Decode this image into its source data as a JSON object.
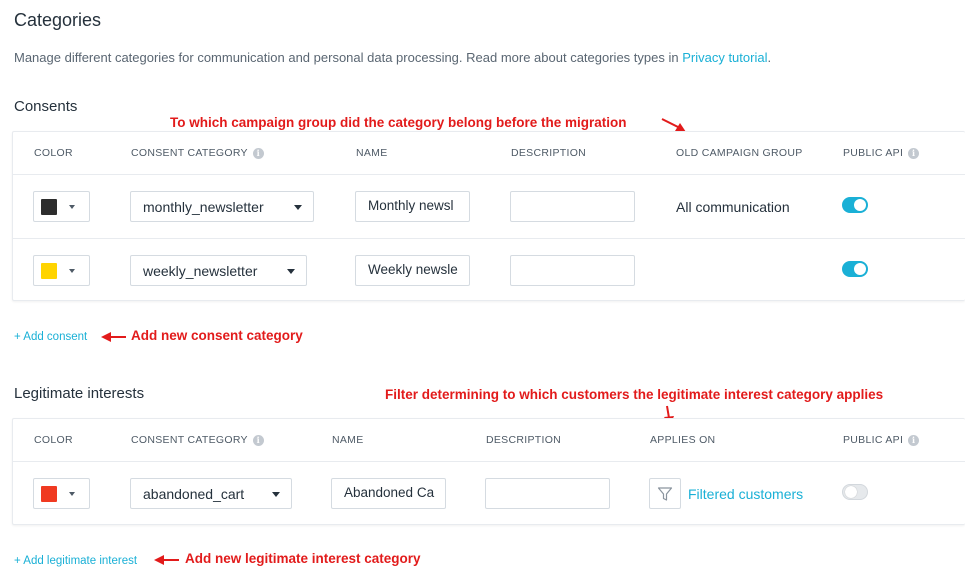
{
  "page": {
    "title": "Categories",
    "description": "Manage different categories for communication and personal data processing. Read more about categories types in ",
    "description_link": "Privacy tutorial",
    "description_end": "."
  },
  "consents": {
    "title": "Consents",
    "columns": {
      "color": "COLOR",
      "consent_category": "CONSENT CATEGORY",
      "name": "NAME",
      "description": "DESCRIPTION",
      "old_campaign_group": "OLD CAMPAIGN GROUP",
      "public_api": "PUBLIC API"
    },
    "rows": [
      {
        "color": "#2d2d2d",
        "category": "monthly_newsletter",
        "name": "Monthly newsl",
        "description": "",
        "old_campaign_group": "All communication",
        "public_api": true
      },
      {
        "color": "#ffd400",
        "category": "weekly_newsletter",
        "name": "Weekly newsle",
        "description": "",
        "old_campaign_group": "",
        "public_api": true
      }
    ],
    "add_label": "+ Add consent"
  },
  "legitimate": {
    "title": "Legitimate interests",
    "columns": {
      "color": "COLOR",
      "consent_category": "CONSENT CATEGORY",
      "name": "NAME",
      "description": "DESCRIPTION",
      "applies_on": "APPLIES ON",
      "public_api": "PUBLIC API"
    },
    "rows": [
      {
        "color": "#f03a21",
        "category": "abandoned_cart",
        "name": "Abandoned Ca",
        "description": "",
        "applies_on": "Filtered customers",
        "public_api": false
      }
    ],
    "add_label": "+ Add legitimate interest"
  },
  "annotations": {
    "campaign_group": "To which campaign group did the category belong before the migration",
    "add_consent": "Add new consent category",
    "filter": "Filter determining to which customers the legitimate interest category applies",
    "add_legitimate": "Add new legitimate interest category"
  },
  "colors": {
    "accent": "#1ab0d6",
    "annotation": "#e21b1b"
  },
  "icons": {
    "info": "info-icon",
    "filter": "filter-icon",
    "dropdown": "chevron-down-icon"
  }
}
